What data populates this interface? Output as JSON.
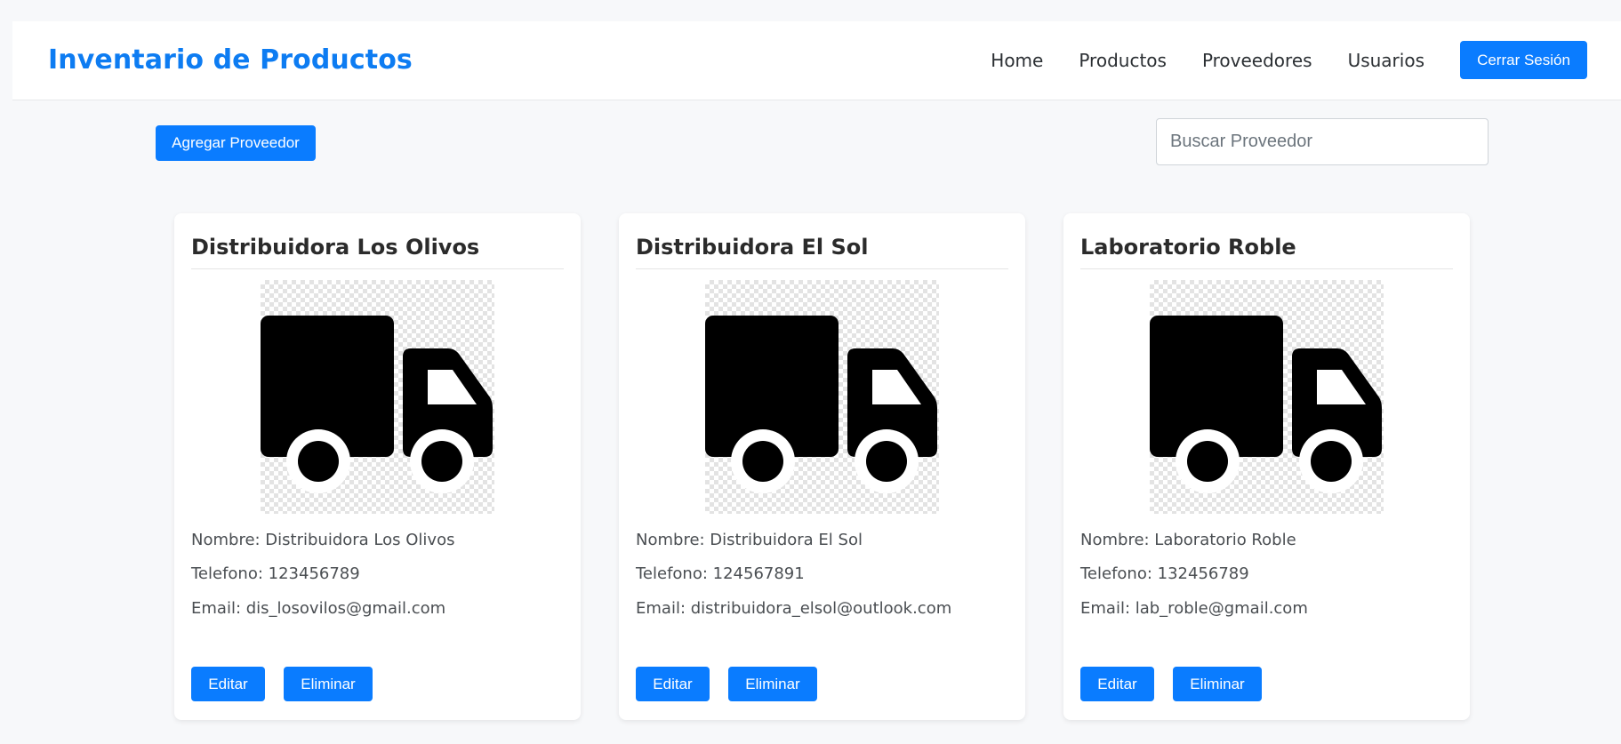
{
  "navbar": {
    "brand": "Inventario de Productos",
    "links": [
      "Home",
      "Productos",
      "Proveedores",
      "Usuarios"
    ],
    "logout_label": "Cerrar Sesión"
  },
  "toolbar": {
    "add_label": "Agregar Proveedor",
    "search_placeholder": "Buscar Proveedor",
    "search_value": ""
  },
  "suppliers": [
    {
      "title": "Distribuidora Los Olivos",
      "nombre": "Nombre: Distribuidora Los Olivos",
      "telefono": "Telefono: 123456789",
      "email": "Email: dis_losovilos@gmail.com",
      "icon": "truck-icon",
      "edit_label": "Editar",
      "delete_label": "Eliminar"
    },
    {
      "title": "Distribuidora El Sol",
      "nombre": "Nombre: Distribuidora El Sol",
      "telefono": "Telefono: 124567891",
      "email": "Email: distribuidora_elsol@outlook.com",
      "icon": "truck-icon",
      "edit_label": "Editar",
      "delete_label": "Eliminar"
    },
    {
      "title": "Laboratorio Roble",
      "nombre": "Nombre: Laboratorio Roble",
      "telefono": "Telefono: 132456789",
      "email": "Email: lab_roble@gmail.com",
      "icon": "truck-icon",
      "edit_label": "Editar",
      "delete_label": "Eliminar"
    }
  ],
  "colors": {
    "brand": "#0d7cf2",
    "button": "#0a7cff",
    "background": "#f7f8fa"
  }
}
